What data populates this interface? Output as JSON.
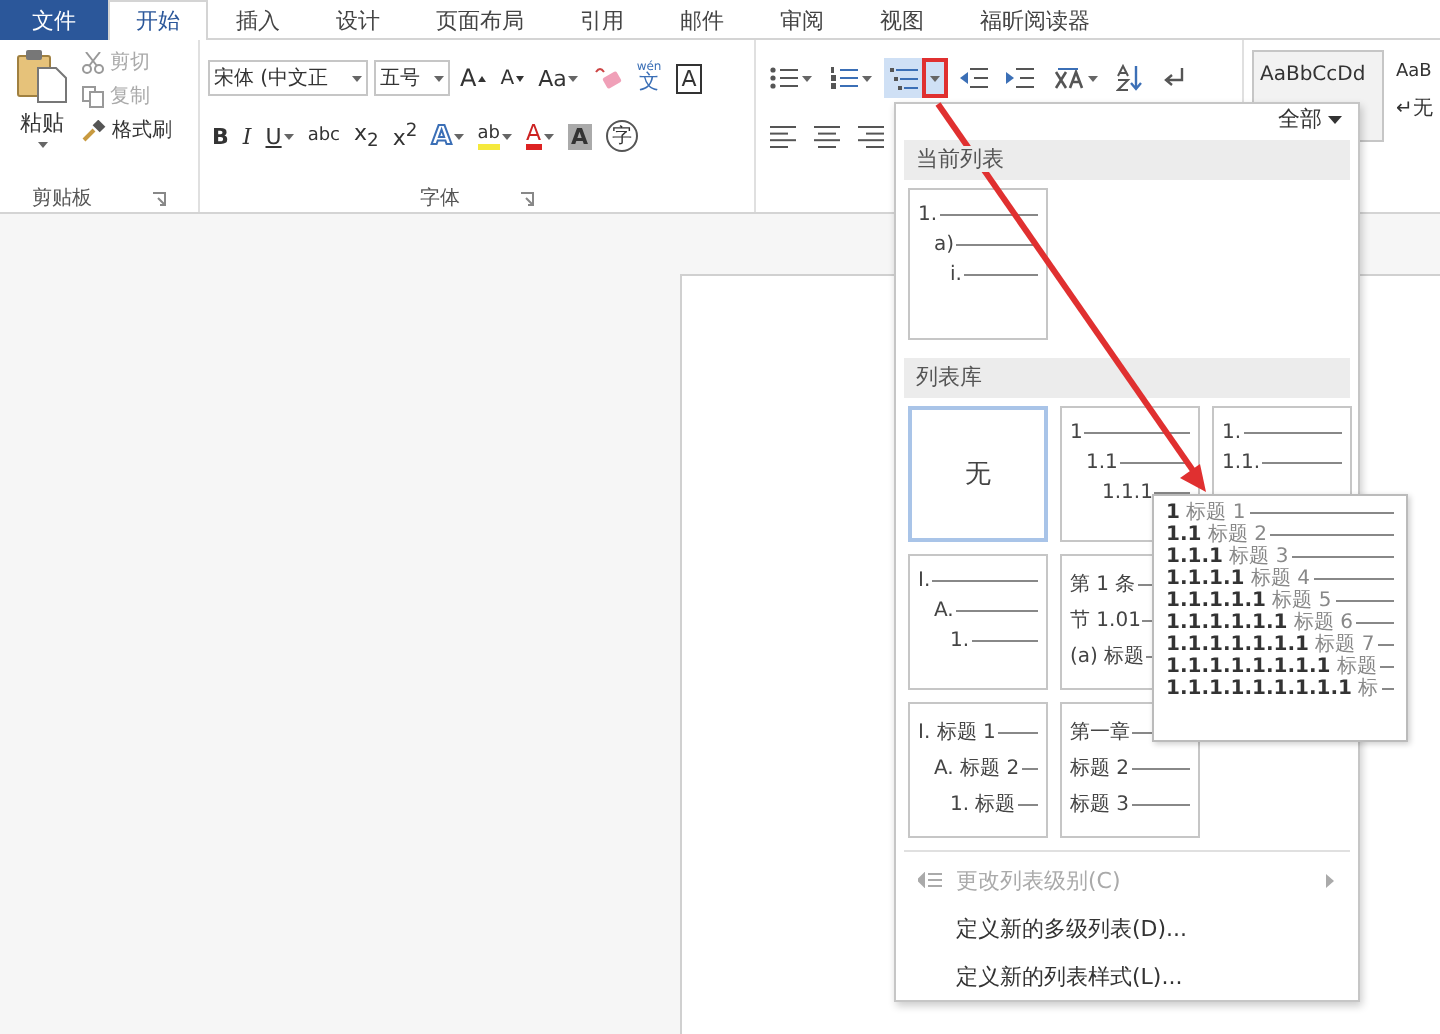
{
  "tabs": [
    {
      "label": "文件",
      "kind": "file",
      "selected": false
    },
    {
      "label": "开始",
      "kind": "tab",
      "selected": true
    },
    {
      "label": "插入",
      "kind": "tab",
      "selected": false
    },
    {
      "label": "设计",
      "kind": "tab",
      "selected": false
    },
    {
      "label": "页面布局",
      "kind": "tab",
      "selected": false
    },
    {
      "label": "引用",
      "kind": "tab",
      "selected": false
    },
    {
      "label": "邮件",
      "kind": "tab",
      "selected": false
    },
    {
      "label": "审阅",
      "kind": "tab",
      "selected": false
    },
    {
      "label": "视图",
      "kind": "tab",
      "selected": false
    },
    {
      "label": "福昕阅读器",
      "kind": "tab",
      "selected": false
    }
  ],
  "clipboard": {
    "paste": "粘贴",
    "label": "剪贴板",
    "commands": [
      {
        "label": "剪切",
        "kind": "cut",
        "disabled": true
      },
      {
        "label": "复制",
        "kind": "copy",
        "disabled": true
      },
      {
        "label": "格式刷",
        "kind": "brush",
        "disabled": false
      }
    ]
  },
  "font": {
    "name": "宋体 (中文正",
    "size": "五号",
    "label": "字体",
    "row1": [
      {
        "kind": "grow",
        "label": "A"
      },
      {
        "kind": "shrink",
        "label": "A"
      },
      {
        "kind": "case",
        "label": "Aa",
        "caret": true
      },
      {
        "kind": "clear"
      },
      {
        "kind": "phonetic",
        "label": "wén",
        "sub": "文"
      },
      {
        "kind": "border",
        "label": "A"
      }
    ],
    "row2": [
      {
        "kind": "bold",
        "label": "B"
      },
      {
        "kind": "italic",
        "label": "I"
      },
      {
        "kind": "underline",
        "label": "U",
        "caret": true
      },
      {
        "kind": "strike",
        "label": "abc"
      },
      {
        "kind": "script",
        "label": "x$_{2}$"
      },
      {
        "kind": "script",
        "label": "x$^{2}$"
      },
      {
        "kind": "effect",
        "label": "A",
        "caret": true
      },
      {
        "kind": "highlight",
        "label": "ab",
        "caret": true
      },
      {
        "kind": "color",
        "label": "A",
        "caret": true
      },
      {
        "kind": "shade",
        "label": "A"
      },
      {
        "kind": "enclose",
        "label": "字"
      }
    ]
  },
  "paragraph": {
    "row1": [
      {
        "kind": "bullets",
        "caret": true,
        "pressed": false
      },
      {
        "kind": "numbering",
        "caret": true,
        "pressed": false
      },
      {
        "kind": "multilevel",
        "caret": true,
        "pressed": true
      },
      {
        "kind": "outdent",
        "caret": false,
        "pressed": false
      },
      {
        "kind": "indent",
        "caret": false,
        "pressed": false
      },
      {
        "kind": "asian",
        "caret": true,
        "pressed": false
      },
      {
        "kind": "sort",
        "caret": false,
        "pressed": false
      },
      {
        "kind": "marks",
        "caret": false,
        "pressed": false
      }
    ],
    "row2": [
      {
        "kind": "align-left"
      },
      {
        "kind": "align-center"
      },
      {
        "kind": "align-right"
      }
    ]
  },
  "styles": [
    {
      "sample": "AaBbCcDd",
      "selected": true
    },
    {
      "sample": "AaB",
      "caption": "↵无",
      "selected": false
    }
  ],
  "multilevel_menu": {
    "filter": "全部",
    "current_section": "当前列表",
    "current_lists": [
      {
        "kind": "lines",
        "indent": true,
        "lines": [
          "1.",
          "a)",
          "i."
        ]
      }
    ],
    "library_section": "列表库",
    "library_rows": [
      [
        {
          "kind": "none",
          "text": "无",
          "selected": true
        },
        {
          "kind": "lines",
          "indent": true,
          "lines": [
            "1",
            "1.1",
            "1.1.1"
          ],
          "selected": false
        },
        {
          "kind": "lines",
          "indent": false,
          "lines": [
            "1.",
            "1.1."
          ],
          "selected": false
        }
      ],
      [
        {
          "kind": "lines",
          "indent": true,
          "lines": [
            "I.",
            "A.",
            "1."
          ],
          "selected": false
        },
        {
          "kind": "lines",
          "indent": false,
          "lines": [
            "第 1 条",
            "节 1.01",
            "(a) 标题"
          ],
          "selected": false
        }
      ],
      [
        {
          "kind": "lines",
          "indent": true,
          "lines": [
            "I. 标题 1",
            "A. 标题 2",
            "1. 标题"
          ],
          "selected": false
        },
        {
          "kind": "lines",
          "indent": false,
          "lines": [
            "第一章",
            "标题 2",
            "标题 3"
          ],
          "selected": false
        }
      ]
    ],
    "preview": [
      "**1** 标题 1",
      "**1.1** 标题 2",
      "**1.1.1** 标题 3",
      "**1.1.1.1** 标题 4",
      "**1.1.1.1.1** 标题 5",
      "**1.1.1.1.1.1** 标题 6",
      "**1.1.1.1.1.1.1** 标题 7",
      "**1.1.1.1.1.1.1.1** 标题",
      "**1.1.1.1.1.1.1.1.1** 标"
    ],
    "commands": [
      {
        "label": "更改列表级别(C)",
        "kind": "submenu",
        "disabled": true
      },
      {
        "label": "定义新的多级列表(D)...",
        "kind": "item",
        "disabled": false
      },
      {
        "label": "定义新的列表样式(L)...",
        "kind": "item",
        "disabled": false
      }
    ]
  }
}
